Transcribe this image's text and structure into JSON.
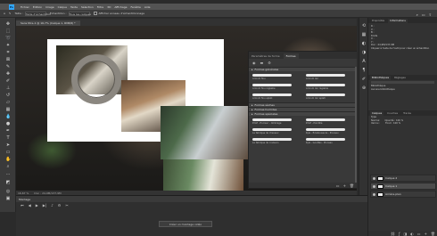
{
  "menu": {
    "logo": "Ps",
    "items": [
      "Fichier",
      "Édition",
      "Image",
      "Calque",
      "Texte",
      "Sélection",
      "Filtre",
      "3D",
      "Affichage",
      "Fenêtre",
      "Aide"
    ]
  },
  "options_bar": {
    "mode_label": "Taille :",
    "mode_value": "Taille d'échantillon",
    "sample_label": "Échantillon :",
    "sample_value": "Tous les calques",
    "show_ring_label": "Afficher anneau d'échantillonnage"
  },
  "document_tab": {
    "title": "Sans titre-1 @ 16,7% (Calque 1, RVB/8) *"
  },
  "status": {
    "zoom": "16,67 %",
    "doc_size": "Doc : 24,9M/137,9M"
  },
  "timeline": {
    "title": "Montage",
    "create_button": "Créer un montage vidéo"
  },
  "brushes_panel": {
    "tabs": [
      "Paramètres de forme",
      "Formes"
    ],
    "active_tab": "Formes",
    "sections": [
      {
        "name": "Formes générales",
        "items": [
          "Arrondi flou",
          "Arrondi dur",
          "Arrondi flou réglable",
          "Arrondi dur réglable",
          "Arrondi flou aplati",
          "Arrondi dur aplati"
        ]
      },
      {
        "name": "Formes sèches",
        "items": []
      },
      {
        "name": "Formes humides",
        "items": []
      },
      {
        "name": "Formes spéciales",
        "items": [
          "KYLE - Encreur - Ombrage",
          "KYLE - Pointillé",
          "La fabrique de cheveux",
          "Kyle - Éclaboussure - Pinceau",
          "La fabrique de couleurs",
          "Kyle - Gouttes - Pinceau"
        ]
      }
    ]
  },
  "right_panel": {
    "top_tabs": [
      "Propriétés",
      "Informations"
    ],
    "active_top_tab": "Informations",
    "info_lines": [
      "R :",
      "V :",
      "B :",
      "8 bits",
      "X :",
      "Y :",
      "Doc : 24,9M/137,9M",
      "Cliquez à l'aide de l'outil pour créer un échantillon"
    ],
    "mid_tabs": [
      "Bibliothèques",
      "Réglages"
    ],
    "mid_lines": [
      "Bibliothèque",
      "Aucune bibliothèque"
    ],
    "layer_tabs": [
      "Calques",
      "Couches",
      "Tracés"
    ],
    "layers_filter": "Type",
    "blend_mode": "Normal",
    "opacity": "Opacité : 100 %",
    "lock_label": "Verrou :",
    "fill": "Fond : 100 %",
    "layers": [
      {
        "name": "Calque 2"
      },
      {
        "name": "Calque 1"
      },
      {
        "name": "Arrière-plan"
      }
    ]
  }
}
